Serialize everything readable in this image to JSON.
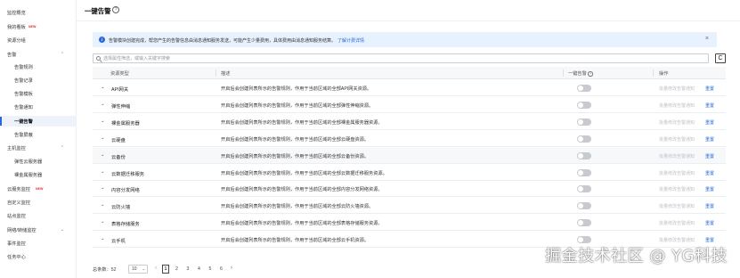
{
  "sidebar": {
    "items": [
      {
        "label": "监控概览",
        "level": 1,
        "badge": ""
      },
      {
        "label": "我的看板",
        "level": 1,
        "badge": "NEW"
      },
      {
        "label": "资源分组",
        "level": 1,
        "badge": ""
      },
      {
        "label": "告警",
        "level": 1,
        "badge": "",
        "expanded": true
      },
      {
        "label": "告警规则",
        "level": 2,
        "badge": ""
      },
      {
        "label": "告警记录",
        "level": 2,
        "badge": ""
      },
      {
        "label": "告警模板",
        "level": 2,
        "badge": ""
      },
      {
        "label": "告警通知",
        "level": 2,
        "badge": ""
      },
      {
        "label": "一键告警",
        "level": 2,
        "badge": "",
        "active": true
      },
      {
        "label": "告警屏蔽",
        "level": 2,
        "badge": ""
      },
      {
        "label": "主机监控",
        "level": 1,
        "badge": "",
        "expanded": true
      },
      {
        "label": "弹性云服务器",
        "level": 2,
        "badge": ""
      },
      {
        "label": "裸金属服务器",
        "level": 2,
        "badge": ""
      },
      {
        "label": "云服务监控",
        "level": 1,
        "badge": "NEW"
      },
      {
        "label": "自定义监控",
        "level": 1,
        "badge": ""
      },
      {
        "label": "站点监控",
        "level": 1,
        "badge": ""
      },
      {
        "label": "网络/转储监控",
        "level": 1,
        "badge": "",
        "collapsed": true
      },
      {
        "label": "事件监控",
        "level": 1,
        "badge": ""
      },
      {
        "label": "任务中心",
        "level": 1,
        "badge": ""
      }
    ]
  },
  "page": {
    "title": "一键告警",
    "help_icon": "?"
  },
  "notice": {
    "icon": "i",
    "text": "告警模块创建完成，帮您产生的告警信息由消息通知服务发送，可能产生少量费用，具体费用由消息通知服务结算。",
    "link": "了解计费详情",
    "close": "×"
  },
  "search": {
    "placeholder": "选择属性筛选，或输入关键字搜索"
  },
  "refresh_icon": "C",
  "table": {
    "columns": [
      "资源类型",
      "描述",
      "一键告警",
      "操作"
    ],
    "help_icon": "?",
    "rows": [
      {
        "name": "API网关",
        "desc": "开启后会创建列表所示的告警规则，作用于当前区域的全部API网关资源。",
        "op_disabled": "批量修改告警通知",
        "op_reset": "重置",
        "enabled": false
      },
      {
        "name": "弹性伸缩",
        "desc": "开启后会创建列表所示的告警规则，作用于当前区域的全部弹性伸缩资源。",
        "op_disabled": "批量修改告警通知",
        "op_reset": "重置",
        "enabled": false
      },
      {
        "name": "裸金属服务器",
        "desc": "开启后会创建列表所示的告警规则，作用于当前区域的全部裸金属服务器资源。",
        "op_disabled": "批量修改告警通知",
        "op_reset": "重置",
        "enabled": false
      },
      {
        "name": "云硬盘",
        "desc": "开启后会创建列表所示的告警规则，作用于当前区域的全部云硬盘资源。",
        "op_disabled": "批量修改告警通知",
        "op_reset": "重置",
        "enabled": false
      },
      {
        "name": "云备份",
        "desc": "开启后会创建列表所示的告警规则，作用于当前区域的全部云备份资源。",
        "op_disabled": "批量修改告警通知",
        "op_reset": "重置",
        "enabled": false
      },
      {
        "name": "云数据迁移服务",
        "desc": "开启后会创建列表所示的告警规则，作用于当前区域的全部云数据迁移服务资源。",
        "op_disabled": "批量修改告警通知",
        "op_reset": "重置",
        "enabled": false
      },
      {
        "name": "内容分发网络",
        "desc": "开启后会创建列表所示的告警规则，作用于当前区域的全部内容分发网络资源。",
        "op_disabled": "批量修改告警通知",
        "op_reset": "重置",
        "enabled": false
      },
      {
        "name": "云防火墙",
        "desc": "开启后会创建列表所示的告警规则，作用于当前区域的全部云防火墙资源。",
        "op_disabled": "批量修改告警通知",
        "op_reset": "重置",
        "enabled": false
      },
      {
        "name": "表格存储服务",
        "desc": "开启后会创建列表所示的告警规则，作用于当前区域的全部表格存储服务资源。",
        "op_disabled": "批量修改告警通知",
        "op_reset": "重置",
        "enabled": false
      },
      {
        "name": "云手机",
        "desc": "开启后会创建列表所示的告警规则，作用于当前区域的全部云手机资源。",
        "op_disabled": "批量修改告警通知",
        "op_reset": "重置",
        "enabled": false
      }
    ]
  },
  "pagination": {
    "total": "总条数：52",
    "page_size": "10",
    "prev": "‹",
    "pages": [
      "1",
      "2",
      "3",
      "4",
      "5",
      "6"
    ],
    "current": "1",
    "next": "›"
  },
  "watermark": "掘金技术社区 @ YG科技",
  "colors": {
    "accent": "#2a6ad8",
    "notice_bg": "#e8f1fe",
    "new_badge": "#e2312c",
    "toggle_off": "#c7cacf"
  }
}
